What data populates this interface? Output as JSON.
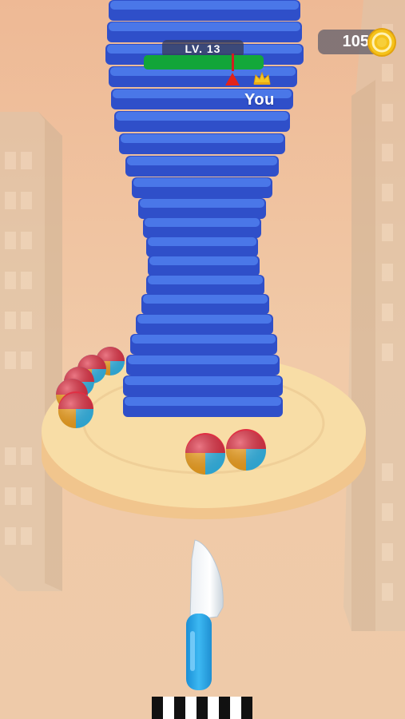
{
  "hud": {
    "level_label": "LV. 13",
    "player_label": "You",
    "coins": "105",
    "progress_fraction": 0.74,
    "player_marker_fraction": 0.74
  },
  "icons": {
    "crown": "crown-icon",
    "coin": "coin-icon",
    "pointer": "player-pointer-icon"
  },
  "colors": {
    "tower_blue": "#2f4fc9",
    "tower_blue_light": "#4a77e8",
    "platform": "#f6d9a1",
    "ball_red": "#e02f43",
    "ball_orange": "#f4a21c",
    "ball_cyan": "#33b8ea",
    "knife_handle": "#2da7ea",
    "progress_green": "#12a539",
    "marker_red": "#e2231a",
    "coin_gold": "#f5c21a"
  }
}
